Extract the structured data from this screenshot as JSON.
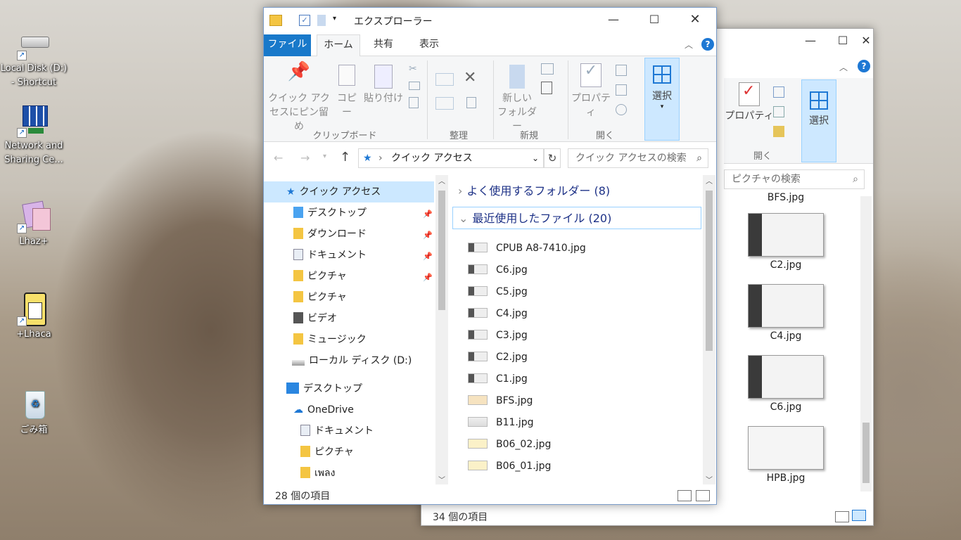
{
  "desktop": {
    "icons": [
      {
        "label": "Local Disk (D:) - Shortcut"
      },
      {
        "label": "Network and Sharing Ce..."
      },
      {
        "label": "Lhaz+"
      },
      {
        "label": "+Lhaca"
      },
      {
        "label": "ごみ箱"
      }
    ]
  },
  "front_window": {
    "title": "エクスプローラー",
    "tabs": {
      "file": "ファイル",
      "home": "ホーム",
      "share": "共有",
      "view": "表示"
    },
    "ribbon": {
      "pin_quick_access": "クイック アクセスにピン留め",
      "copy": "コピー",
      "paste": "貼り付け",
      "clipboard_group": "クリップボード",
      "organize_group": "整理",
      "new_folder": "新しい フォルダー",
      "new_group": "新規",
      "properties": "プロパティ",
      "open_group": "開く",
      "select": "選択"
    },
    "address": "クイック アクセス",
    "search_placeholder": "クイック アクセスの検索",
    "nav": {
      "quick_access": "クイック アクセス",
      "desktop": "デスクトップ",
      "downloads": "ダウンロード",
      "documents": "ドキュメント",
      "pictures": "ピクチャ",
      "pictures2": "ピクチャ",
      "videos": "ビデオ",
      "music": "ミュージック",
      "local_disk": "ローカル ディスク (D:)",
      "desktop2": "デスクトップ",
      "onedrive": "OneDrive",
      "od_documents": "ドキュメント",
      "od_pictures": "ピクチャ",
      "od_other": "เพลง"
    },
    "groups": {
      "frequent": "よく使用するフォルダー (8)",
      "recent": "最近使用したファイル (20)"
    },
    "files": [
      "CPUB A8-7410.jpg",
      "C6.jpg",
      "C5.jpg",
      "C4.jpg",
      "C3.jpg",
      "C2.jpg",
      "C1.jpg",
      "BFS.jpg",
      "B11.jpg",
      "B06_02.jpg",
      "B06_01.jpg"
    ],
    "status": "28 個の項目"
  },
  "back_window": {
    "properties": "プロパティ",
    "select": "選択",
    "open_group": "開く",
    "search_placeholder": "ピクチャの検索",
    "thumbs": [
      "BFS.jpg",
      "C2.jpg",
      "C4.jpg",
      "C6.jpg",
      "HPB.jpg"
    ],
    "status": "34 個の項目"
  }
}
